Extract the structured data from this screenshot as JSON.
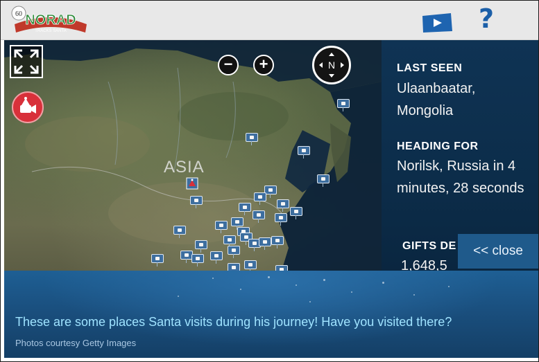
{
  "header": {
    "logo": {
      "text": "NORAD",
      "subtext": "TRACKS SANTA",
      "badge": "60"
    },
    "video_icon": "video-play-icon",
    "help_label": "?"
  },
  "map": {
    "region_label": "ASIA",
    "controls": {
      "fullscreen_icon": "fullscreen-icon",
      "zoom_out_label": "−",
      "zoom_in_label": "+",
      "compass_label": "N",
      "camera_icon": "santa-cam-icon"
    },
    "colors": {
      "land": "#5d6647",
      "ocean": "#0c2238",
      "pin": "#3d6e9f",
      "santa_marker": "#d8303a"
    }
  },
  "status": {
    "last_seen_heading": "LAST SEEN",
    "last_seen_value": "Ulaanbaatar, Mongolia",
    "heading_for_heading": "HEADING FOR",
    "heading_for_value": "Norilsk, Russia in 4 minutes, 28 seconds",
    "gifts_heading": "GIFTS DE",
    "gifts_value": "1,648,5"
  },
  "close_button": {
    "label": "<< close"
  },
  "panel": {
    "message": "These are some places Santa visits during his journey! Have you visited there?",
    "credit": "Photos courtesy Getty Images"
  }
}
